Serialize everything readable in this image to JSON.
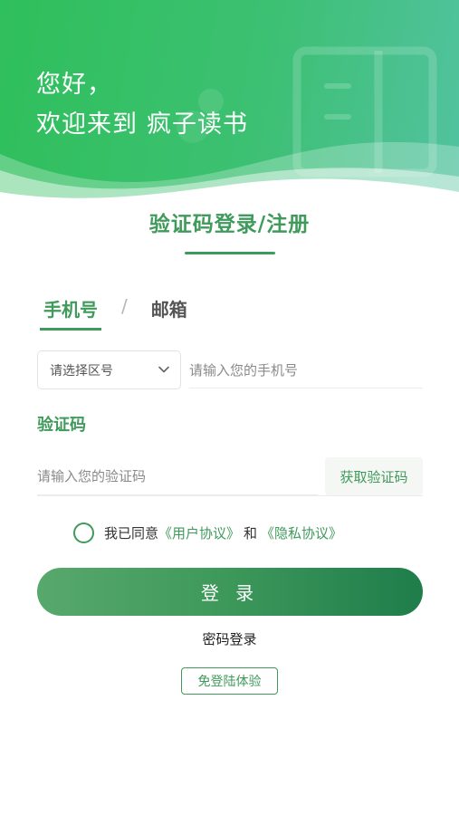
{
  "header": {
    "greeting_line1": "您好，",
    "greeting_line2": "欢迎来到",
    "app_name": "疯子读书"
  },
  "form": {
    "title": "验证码登录/注册",
    "tabs": [
      {
        "label": "手机号",
        "active": true
      },
      {
        "label": "邮箱",
        "active": false
      }
    ],
    "tab_separator": "/",
    "region_select": {
      "selected": "请选择区号"
    },
    "phone_input": {
      "placeholder": "请输入您的手机号",
      "value": ""
    },
    "code_label": "验证码",
    "code_input": {
      "placeholder": "请输入您的验证码",
      "value": ""
    },
    "get_code_label": "获取验证码",
    "agreement": {
      "checked": false,
      "prefix": "我已同意",
      "user_agreement": "《用户协议》",
      "conjunction": "和",
      "privacy_policy": "《隐私协议》"
    },
    "login_label": "登 录",
    "password_login_label": "密码登录",
    "guest_label": "免登陆体验"
  },
  "colors": {
    "accent": "#3f9a5b",
    "header_start": "#2fbf5b",
    "header_end": "#52c2a0",
    "button_dark": "#1f7d4b"
  }
}
